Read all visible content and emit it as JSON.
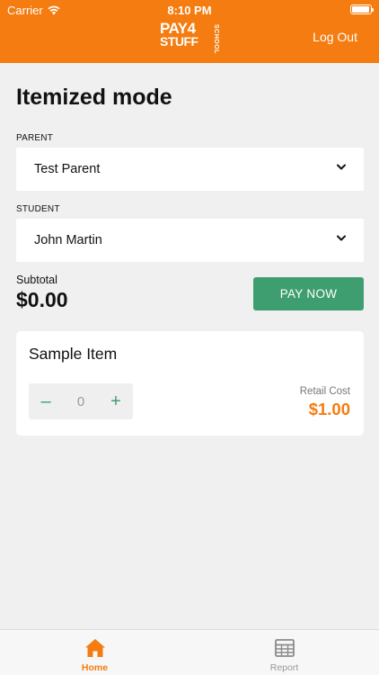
{
  "status_bar": {
    "carrier": "Carrier",
    "time": "8:10 PM",
    "icons": [
      "wifi-icon",
      "battery-icon"
    ]
  },
  "header": {
    "logo": {
      "line1": "PAY4",
      "line2": "STUFF",
      "line3": "SCHOOL"
    },
    "logout_label": "Log Out",
    "accent_color": "#f47c10"
  },
  "main": {
    "title": "Itemized mode",
    "parent": {
      "label": "PARENT",
      "value": "Test Parent"
    },
    "student": {
      "label": "STUDENT",
      "value": "John Martin"
    },
    "subtotal": {
      "label": "Subtotal",
      "value": "$0.00"
    },
    "pay_button_label": "PAY NOW",
    "pay_button_color": "#3f9e6f"
  },
  "items": [
    {
      "name": "Sample Item",
      "quantity": "0",
      "minus_label": "–",
      "plus_label": "+",
      "retail_label": "Retail Cost",
      "retail_value": "$1.00"
    }
  ],
  "tabbar": {
    "tabs": [
      {
        "label": "Home",
        "icon": "home-icon",
        "active": true
      },
      {
        "label": "Report",
        "icon": "table-icon",
        "active": false
      }
    ]
  }
}
